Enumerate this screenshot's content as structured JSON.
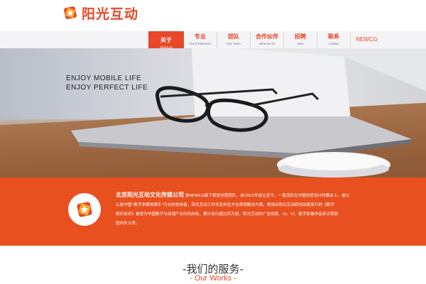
{
  "brand": {
    "logo_text": "阳光互动",
    "accent_color": "#e8472a",
    "band_color": "#e8501f",
    "logo_icon": "star-badge-icon"
  },
  "nav": {
    "items": [
      {
        "cn": "关于",
        "en": "About us",
        "active": true
      },
      {
        "cn": "专业",
        "en": "Our Profession"
      },
      {
        "cn": "团队",
        "en": "Our Team"
      },
      {
        "cn": "合作伙伴",
        "en": "what we do"
      },
      {
        "cn": "招聘",
        "en": "jobs"
      },
      {
        "cn": "联系",
        "en": "contact"
      },
      {
        "cn": "NEWCG",
        "en": ""
      }
    ]
  },
  "hero": {
    "line1": "ENJOY MOBILE LIFE",
    "line2": "ENJOY PERFECT LIFE"
  },
  "intro": {
    "company": "北京阳光互动文化传媒公司",
    "line1": "是NEWCG旗下视觉创意团队，自2001年成立至今，一直活跃在中国创意设计的舞台上，被公",
    "line2": "认是中国“数字多媒体娱乐”行业的佼佼者，阳光互动工作涉及到全方位视觉解决方案。视觉由阳光互动原创出版发行的《数字",
    "line3": "娱乐技术》被誉为中国数字与动漫产业的风向标，累计发行超过百万册，阳光互动的广告创意、UI、VI、数字影像作品多次荣获",
    "line4": "国内外大奖。"
  },
  "services": {
    "title_cn": "-我们的服务-",
    "title_en": "- Our Works -"
  }
}
